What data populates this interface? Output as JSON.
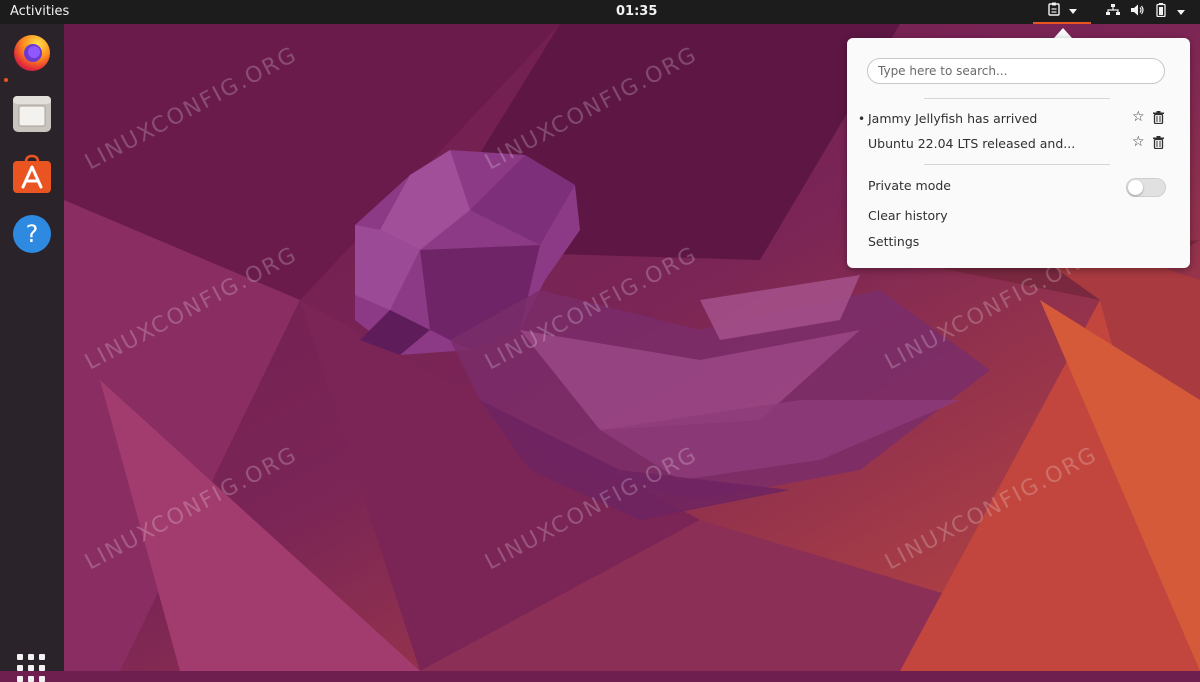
{
  "topbar": {
    "activities_label": "Activities",
    "clock": "01:35",
    "tray_icons": [
      "clipboard-icon",
      "network-icon",
      "volume-icon",
      "battery-icon"
    ]
  },
  "dock": {
    "apps": [
      {
        "name": "Firefox",
        "icon": "firefox-icon",
        "running": true
      },
      {
        "name": "Files",
        "icon": "files-icon",
        "running": false
      },
      {
        "name": "Ubuntu Software",
        "icon": "software-icon",
        "running": false
      },
      {
        "name": "Help",
        "icon": "help-icon",
        "running": false
      }
    ],
    "show_apps_icon": "app-grid-icon",
    "accent": "#e95420"
  },
  "wallpaper": {
    "watermark": "LINUXCONFIG.ORG"
  },
  "clipboard_popup": {
    "search_placeholder": "Type here to search...",
    "history": [
      {
        "text": "Jammy Jellyfish has arrived",
        "current": true,
        "bullet": "•"
      },
      {
        "text": "Ubuntu 22.04 LTS released and...",
        "current": false,
        "bullet": ""
      }
    ],
    "private_mode_label": "Private mode",
    "private_mode_on": false,
    "clear_history_label": "Clear history",
    "settings_label": "Settings"
  }
}
